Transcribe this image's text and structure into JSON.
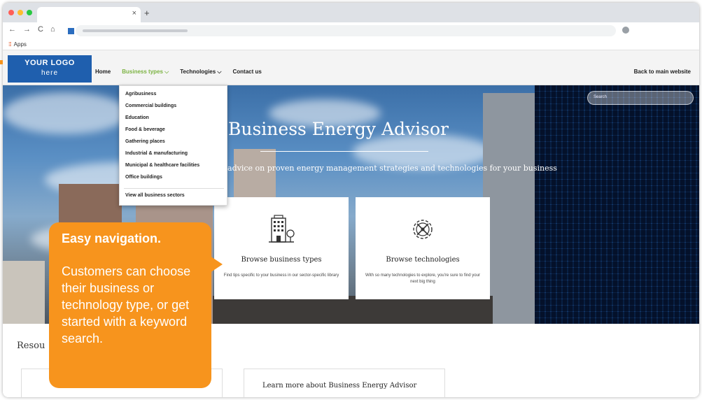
{
  "browser": {
    "tab_close": "×",
    "new_tab": "+",
    "nav_back": "←",
    "nav_forward": "→",
    "reload": "C",
    "home": "⌂",
    "bookmark_apps": "Apps",
    "dot_colors": [
      "#ff5f57",
      "#febc2e",
      "#28c840"
    ]
  },
  "site": {
    "logo_line1": "YOUR LOGO",
    "logo_line2": "here",
    "nav": [
      {
        "label": "Home"
      },
      {
        "label": "Business types ⌵"
      },
      {
        "label": "Technologies ⌵"
      },
      {
        "label": "Contact us"
      }
    ],
    "back_link": "Back to main website",
    "search_placeholder": "Search"
  },
  "dropdown": {
    "items": [
      "Agribusiness",
      "Commercial buildings",
      "Education",
      "Food & beverage",
      "Gathering places",
      "Industrial & manufacturing",
      "Municipal & healthcare facilities",
      "Office buildings"
    ],
    "view_all": "View all business sectors"
  },
  "hero": {
    "title": "Business Energy Advisor",
    "subtitle": "e advice on proven energy management strategies and technologies for your business"
  },
  "cards": [
    {
      "title": "Browse business types",
      "desc": "Find tips specific to your business in our sector-specific library"
    },
    {
      "title": "Browse technologies",
      "desc": "With so many technologies to explore, you're sure to find your next big thing"
    }
  ],
  "lower": {
    "resources_heading": "Resou",
    "learn_more": "Learn more about Business Energy Advisor"
  },
  "callout": {
    "heading": "Easy navigation.",
    "body": "Customers can choose their business or technology  type, or get started with a keyword search."
  },
  "colors": {
    "logo_bg": "#1f5fae",
    "active_nav": "#7cb342",
    "callout": "#f7941d"
  }
}
